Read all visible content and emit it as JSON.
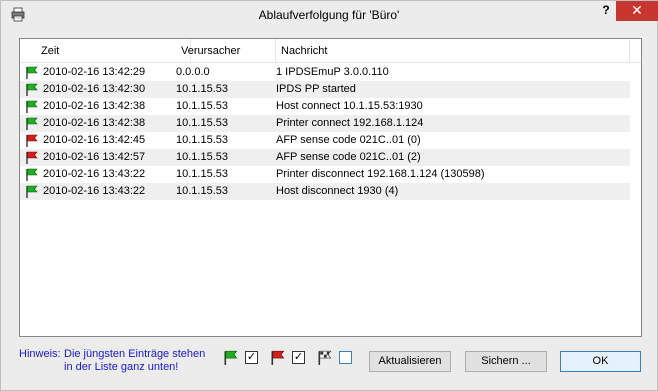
{
  "window": {
    "title": "Ablaufverfolgung für 'Büro'",
    "help_label": "?",
    "close_label": "✕"
  },
  "columns": {
    "time": "Zeit",
    "source": "Verursacher",
    "message": "Nachricht"
  },
  "rows": [
    {
      "flag": "green",
      "time": "2010-02-16 13:42:29",
      "source": "0.0.0.0",
      "message": "1  IPDSEmuP  3.0.0.110"
    },
    {
      "flag": "green",
      "time": "2010-02-16 13:42:30",
      "source": "10.1.15.53",
      "message": "IPDS PP started"
    },
    {
      "flag": "green",
      "time": "2010-02-16 13:42:38",
      "source": "10.1.15.53",
      "message": "Host connect 10.1.15.53:1930"
    },
    {
      "flag": "green",
      "time": "2010-02-16 13:42:38",
      "source": "10.1.15.53",
      "message": "Printer connect 192.168.1.124"
    },
    {
      "flag": "red",
      "time": "2010-02-16 13:42:45",
      "source": "10.1.15.53",
      "message": "AFP sense code 021C..01 (0)"
    },
    {
      "flag": "red",
      "time": "2010-02-16 13:42:57",
      "source": "10.1.15.53",
      "message": "AFP sense code 021C..01 (2)"
    },
    {
      "flag": "green",
      "time": "2010-02-16 13:43:22",
      "source": "10.1.15.53",
      "message": "Printer disconnect 192.168.1.124 (130598)"
    },
    {
      "flag": "green",
      "time": "2010-02-16 13:43:22",
      "source": "10.1.15.53",
      "message": "Host disconnect 1930 (4)"
    }
  ],
  "hint": {
    "label": "Hinweis:",
    "text": "Die jüngsten Einträge stehen in der Liste ganz unten!"
  },
  "filters": [
    {
      "icon": "green-flag-icon",
      "checked": true
    },
    {
      "icon": "red-flag-icon",
      "checked": true
    },
    {
      "icon": "checkered-flag-icon",
      "checked": false
    }
  ],
  "buttons": {
    "refresh": "Aktualisieren",
    "save": "Sichern ...",
    "ok": "OK"
  },
  "colors": {
    "flag_green": "#1fae1f",
    "flag_red": "#d21e1e",
    "hint_text": "#1a1acc",
    "close_bg": "#c7372f"
  }
}
